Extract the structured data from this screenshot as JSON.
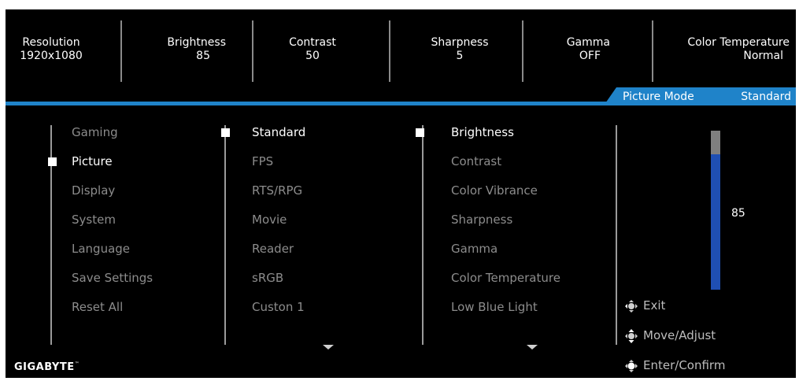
{
  "status": {
    "resolution": {
      "label": "Resolution",
      "value": "1920x1080"
    },
    "brightness": {
      "label": "Brightness",
      "value": "85"
    },
    "contrast": {
      "label": "Contrast",
      "value": "50"
    },
    "sharpness": {
      "label": "Sharpness",
      "value": "5"
    },
    "gamma": {
      "label": "Gamma",
      "value": "OFF"
    },
    "color_temperature": {
      "label": "Color Temperature",
      "value": "Normal"
    }
  },
  "picture_mode": {
    "label": "Picture Mode",
    "value": "Standard"
  },
  "main_menu": {
    "items": [
      {
        "label": "Gaming"
      },
      {
        "label": "Picture",
        "selected": true
      },
      {
        "label": "Display"
      },
      {
        "label": "System"
      },
      {
        "label": "Language"
      },
      {
        "label": "Save Settings"
      },
      {
        "label": "Reset All"
      }
    ]
  },
  "mode_menu": {
    "items": [
      {
        "label": "Standard",
        "selected": true
      },
      {
        "label": "FPS"
      },
      {
        "label": "RTS/RPG"
      },
      {
        "label": "Movie"
      },
      {
        "label": "Reader"
      },
      {
        "label": "sRGB"
      },
      {
        "label": "Custon 1"
      }
    ]
  },
  "setting_menu": {
    "items": [
      {
        "label": "Brightness",
        "selected": true
      },
      {
        "label": "Contrast"
      },
      {
        "label": "Color Vibrance"
      },
      {
        "label": "Sharpness"
      },
      {
        "label": "Gamma"
      },
      {
        "label": "Color Temperature"
      },
      {
        "label": "Low Blue Light"
      }
    ]
  },
  "slider": {
    "value": "85",
    "fraction": 0.85,
    "track_color": "#7f7f7f",
    "fill_color": "#1f4fb3"
  },
  "hints": [
    {
      "icon": "joystick-left-icon",
      "label": "Exit"
    },
    {
      "icon": "joystick-all-directions-icon",
      "label": "Move/Adjust"
    },
    {
      "icon": "joystick-press-icon",
      "label": "Enter/Confirm"
    }
  ],
  "brand": {
    "name": "GIGABYTE",
    "mark": "™"
  },
  "colors": {
    "accent": "#1f83c9",
    "background": "#000000",
    "dim_text": "#8c8c8c"
  }
}
